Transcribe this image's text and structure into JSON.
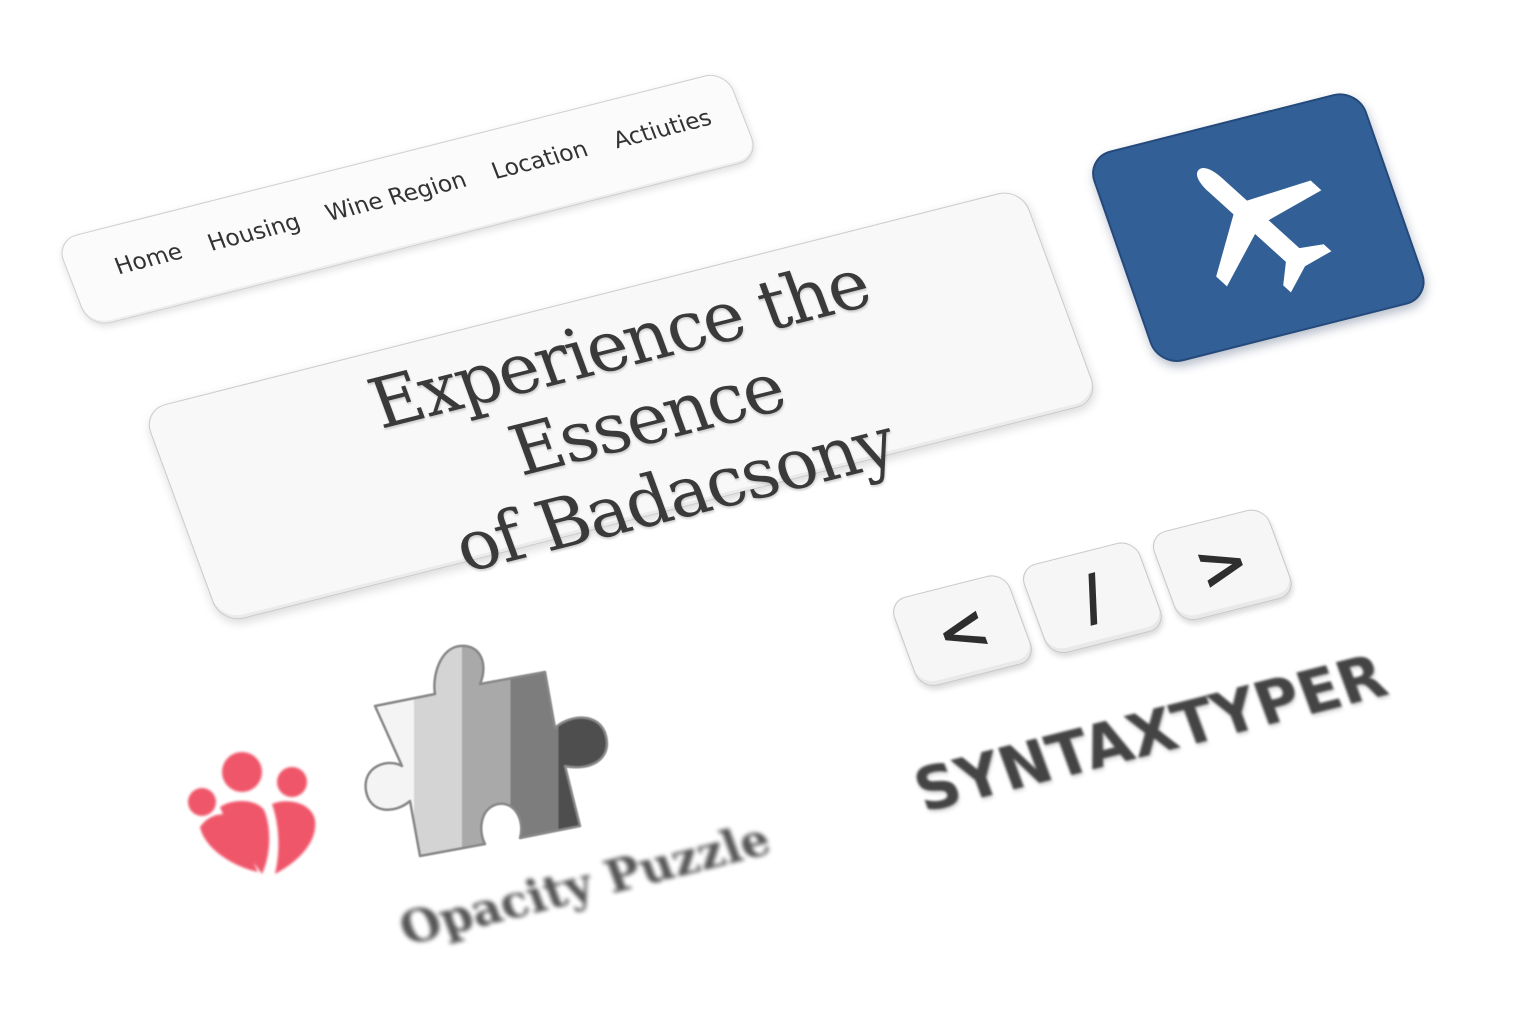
{
  "nav": {
    "items": [
      {
        "label": "Home"
      },
      {
        "label": "Housing"
      },
      {
        "label": "Wine Region"
      },
      {
        "label": "Location"
      },
      {
        "label": "Actiuties"
      }
    ]
  },
  "hero": {
    "title_line1": "Experience the Essence",
    "title_line2": "of Badacsony"
  },
  "app_icon": {
    "icon": "airplane-icon",
    "color": "#326096"
  },
  "syntax_logo": {
    "keys": [
      "<",
      "/",
      ">"
    ],
    "wordmark": "SYNTAXTYPER"
  },
  "puzzle_logo": {
    "icon": "puzzle-piece-icon",
    "wordmark": "Opacity Puzzle"
  },
  "people_logo": {
    "icon": "people-group-icon",
    "color": "#f0566a"
  }
}
